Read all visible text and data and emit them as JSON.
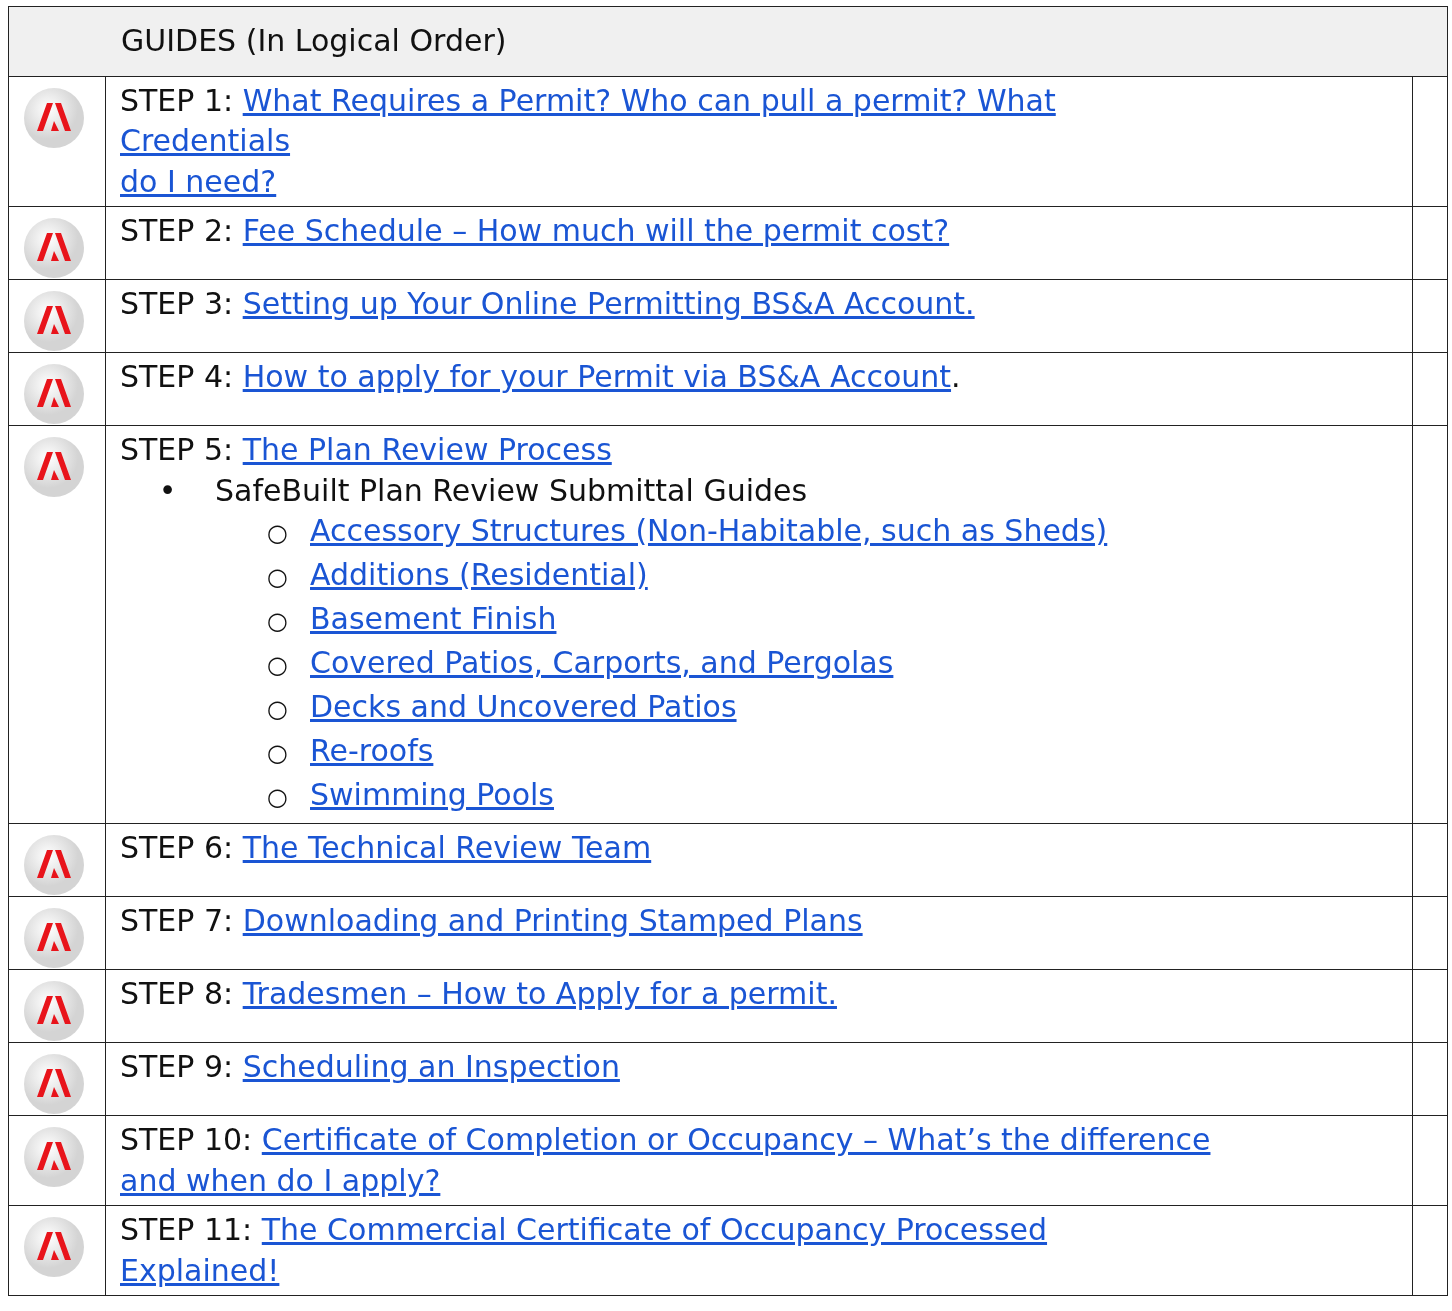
{
  "table": {
    "header": "GUIDES (In Logical Order)",
    "rows": [
      {
        "step": "STEP 1:",
        "link": "What Requires a Permit?  Who can pull a permit?  What",
        "link_lines": [
          "Credentials",
          "do I need?"
        ]
      },
      {
        "step": "STEP 2:",
        "link": "Fee Schedule – How much will the permit cost?"
      },
      {
        "step": "STEP 3:",
        "link": "Setting up Your Online Permitting BS&A Account."
      },
      {
        "step": "STEP 4:",
        "link": "How to apply for your Permit via BS&A Account",
        "suffix": "."
      },
      {
        "step": "STEP 5:",
        "link": "The Plan Review Process",
        "items": [
          {
            "bullet": "•",
            "text": "SafeBuilt Plan Review Submittal Guides",
            "children": [
              {
                "bullet": "○",
                "link": "Accessory Structures (Non-Habitable, such as Sheds)"
              },
              {
                "bullet": "○",
                "link": "Additions (Residential)"
              },
              {
                "bullet": "○",
                "link": "Basement Finish"
              },
              {
                "bullet": "○",
                "link": "Covered Patios, Carports, and Pergolas"
              },
              {
                "bullet": "○",
                "link": "Decks and Uncovered Patios"
              },
              {
                "bullet": "○",
                "link": "Re-roofs"
              },
              {
                "bullet": "○",
                "link": "Swimming Pools"
              }
            ]
          }
        ]
      },
      {
        "step": "STEP 6:",
        "link": "The Technical Review Team"
      },
      {
        "step": "STEP 7:",
        "link": "Downloading and Printing Stamped Plans"
      },
      {
        "step": "STEP 8:",
        "link": "Tradesmen – How to Apply for a permit."
      },
      {
        "step": "STEP 9:",
        "link": "Scheduling an Inspection"
      },
      {
        "step": "STEP 10:",
        "link": "Certificate of Completion or Occupancy – What’s the difference",
        "link_lines": [
          "and when do I apply?"
        ]
      },
      {
        "step": "STEP 11:",
        "link": "The Commercial Certificate of Occupancy Processed",
        "link_lines": [
          "Explained!"
        ]
      }
    ]
  }
}
